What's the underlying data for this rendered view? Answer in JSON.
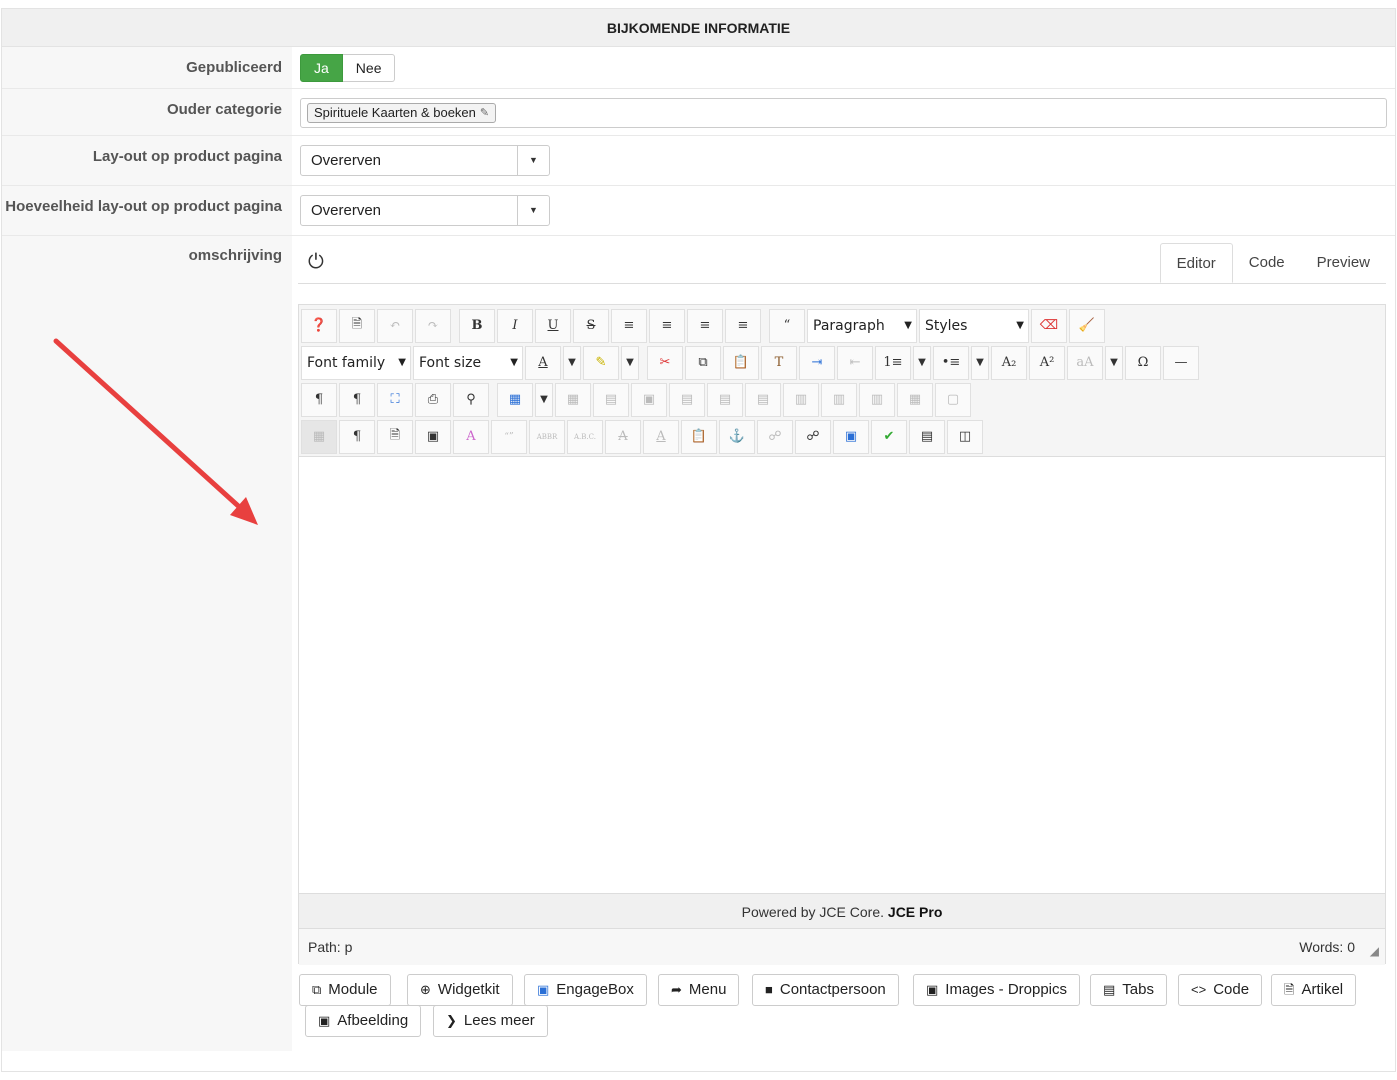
{
  "header": {
    "title": "BIJKOMENDE INFORMATIE"
  },
  "fields": {
    "published": {
      "label": "Gepubliceerd",
      "yes": "Ja",
      "no": "Nee"
    },
    "parent_category": {
      "label": "Ouder categorie",
      "tag": "Spirituele Kaarten & boeken"
    },
    "layout": {
      "label": "Lay-out op product pagina",
      "value": "Overerven"
    },
    "quantity_layout": {
      "label": "Hoeveelheid lay-out op product pagina",
      "value": "Overerven"
    },
    "description": {
      "label": "omschrijving"
    }
  },
  "editor": {
    "tabs": [
      "Editor",
      "Code",
      "Preview"
    ],
    "format_select": "Paragraph",
    "styles_select": "Styles",
    "font_family": "Font family",
    "font_size": "Font size",
    "powered_by": "Powered by JCE Core.",
    "powered_pro": "JCE Pro",
    "path_label": "Path:",
    "path_value": "p",
    "words": "Words: 0"
  },
  "extensions": [
    {
      "label": "Module",
      "icon": "module-icon"
    },
    {
      "label": "Widgetkit",
      "icon": "plus-circle-icon"
    },
    {
      "label": "EngageBox",
      "icon": "square-icon"
    },
    {
      "label": "Menu",
      "icon": "share-icon"
    },
    {
      "label": "Contactpersoon",
      "icon": "contact-icon"
    },
    {
      "label": "Images - Droppics",
      "icon": "image-icon"
    },
    {
      "label": "Tabs",
      "icon": "tabs-icon"
    },
    {
      "label": "Code",
      "icon": "code-icon"
    },
    {
      "label": "Artikel",
      "icon": "file-add-icon"
    },
    {
      "label": "Afbeelding",
      "icon": "image-icon"
    },
    {
      "label": "Lees meer",
      "icon": "chevron-down-icon"
    }
  ],
  "colors": {
    "accent_green": "#46a546",
    "arrow_red": "#e8403f"
  }
}
